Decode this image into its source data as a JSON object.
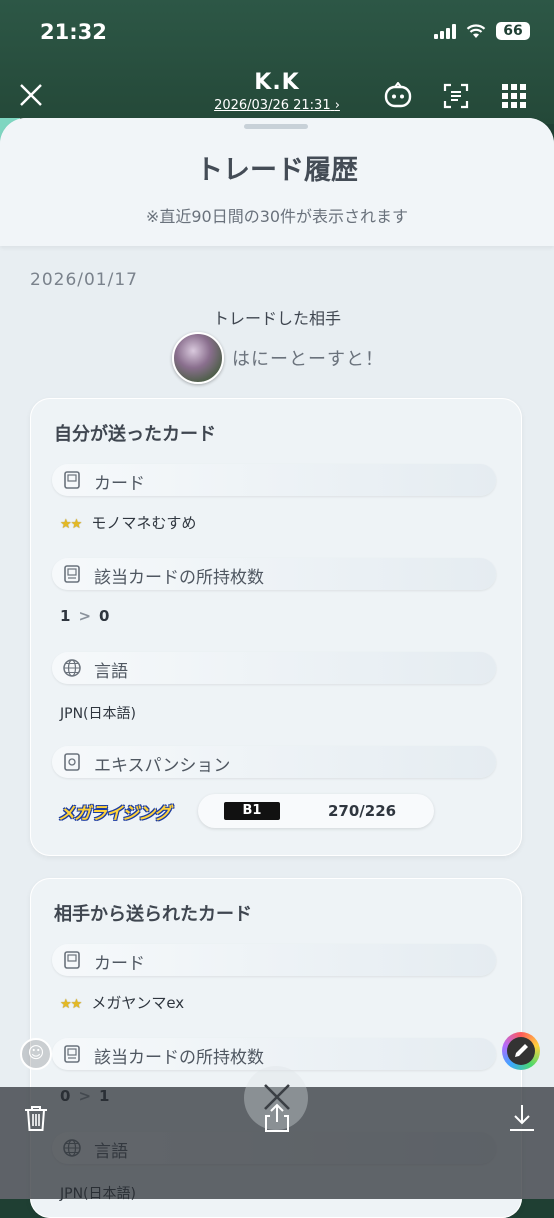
{
  "status_bar": {
    "time": "21:32",
    "battery": "66"
  },
  "header": {
    "title": "K.K",
    "subtitle": "2026/03/26 21:31",
    "subtitle_chevron": "›"
  },
  "page": {
    "title": "トレード履歴",
    "note": "※直近90日間の30件が表示されます"
  },
  "trade": {
    "date": "2026/01/17",
    "partner_label": "トレードした相手",
    "partner_name": "はにーとーすと！"
  },
  "sent": {
    "title": "自分が送ったカード",
    "card_label": "カード",
    "card_stars": "★★",
    "card_name": "モノマネむすめ",
    "count_label": "該当カードの所持枚数",
    "count_from": "1",
    "count_arrow": ">",
    "count_to": "0",
    "lang_label": "言語",
    "lang_value": "JPN(日本語)",
    "exp_label": "エキスパンション",
    "exp_logo": "メガライジング",
    "set_code": "B1",
    "set_number": "270/226"
  },
  "received": {
    "title": "相手から送られたカード",
    "card_label": "カード",
    "card_stars": "★★",
    "card_name": "メガヤンマex",
    "count_label": "該当カードの所持枚数",
    "count_from": "0",
    "count_arrow": ">",
    "count_to": "1",
    "lang_label": "言語",
    "lang_value": "JPN(日本語)"
  },
  "icons": {
    "close": "close-icon",
    "chat": "chat-bubble-icon",
    "scan": "scan-text-icon",
    "grid": "grid-menu-icon",
    "emoji": "emoji-icon",
    "pen": "pen-icon",
    "trash": "trash-icon",
    "share": "share-icon",
    "download": "download-icon"
  },
  "colors": {
    "header_bg": "#2d5746",
    "panel_bg": "#e8eef2",
    "star": "#e4b923"
  }
}
